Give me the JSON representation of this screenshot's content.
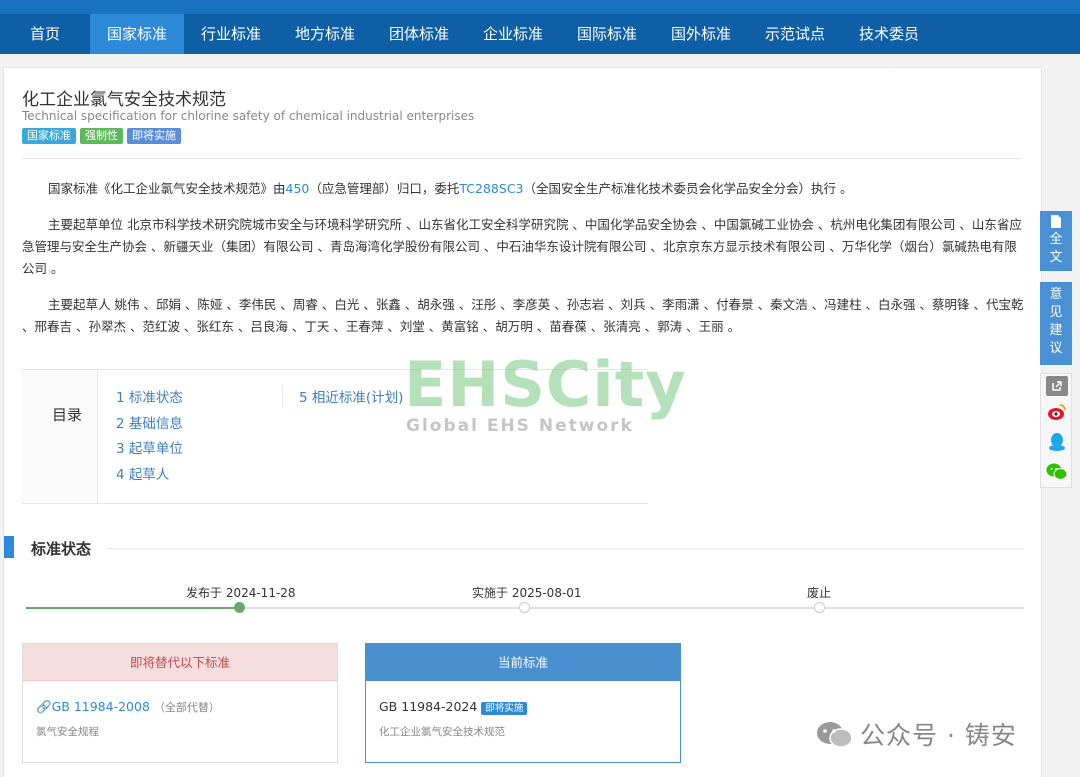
{
  "nav": {
    "items": [
      "首页",
      "国家标准",
      "行业标准",
      "地方标准",
      "团体标准",
      "企业标准",
      "国际标准",
      "国外标准",
      "示范试点",
      "技术委员会"
    ],
    "active_index": 1
  },
  "standard": {
    "title_zh": "化工企业氯气安全技术规范",
    "title_en": "Technical specification for chlorine safety of chemical industrial enterprises",
    "tags": [
      "国家标准",
      "强制性",
      "即将实施"
    ]
  },
  "paragraphs": {
    "p1_prefix": "国家标准《化工企业氯气安全技术规范》由",
    "p1_link1": "450",
    "p1_mid": "（应急管理部）归口，委托",
    "p1_link2": "TC288SC3",
    "p1_suffix": "（全国安全生产标准化技术委员会化学品安全分会）执行 。",
    "p2": "主要起草单位 北京市科学技术研究院城市安全与环境科学研究所 、山东省化工安全科学研究院 、中国化学品安全协会 、中国氯碱工业协会 、杭州电化集团有限公司 、山东省应急管理与安全生产协会 、新疆天业（集团）有限公司 、青岛海湾化学股份有限公司 、中石油华东设计院有限公司 、北京京东方显示技术有限公司 、万华化学（烟台）氯碱热电有限公司 。",
    "p3": "主要起草人 姚伟 、邱娟 、陈娅 、李伟民 、周睿 、白光 、张鑫 、胡永强 、汪彤 、李彦英 、孙志岩 、刘兵 、李雨潇 、付春景 、秦文浩 、冯建柱 、白永强 、蔡明锋 、代宝乾 、邢春吉 、孙翠杰 、范红波 、张红东 、吕良海 、丁天 、王春萍 、刘堂 、黄富铭 、胡万明 、苗春葆 、张清亮 、郭涛 、王丽 。"
  },
  "toc": {
    "label": "目录",
    "col1": [
      "1 标准状态",
      "2 基础信息",
      "3 起草单位",
      "4 起草人"
    ],
    "col2": [
      "5 相近标准(计划)"
    ]
  },
  "watermark": {
    "big": "EHSCity",
    "small": "Global EHS Network"
  },
  "status": {
    "title": "标准状态",
    "timeline": [
      "发布于 2024-11-28",
      "实施于 2025-08-01",
      "废止"
    ],
    "replace_box": {
      "header": "即将替代以下标准",
      "code": "GB 11984-2008",
      "note": "（全部代替）",
      "name": "氯气安全规程"
    },
    "current_box": {
      "header": "当前标准",
      "code": "GB 11984-2024",
      "badge": "即将实施",
      "name": "化工企业氯气安全技术规范"
    }
  },
  "side": {
    "full_text": "全文",
    "suggest": "意见建议"
  },
  "footer": {
    "wechat_text": "公众号 · 铸安"
  },
  "colors": {
    "nav_bg": "#0f5fa6",
    "nav_active": "#2d8ad8",
    "link": "#2d8ad8",
    "progress": "#6aa86a"
  }
}
